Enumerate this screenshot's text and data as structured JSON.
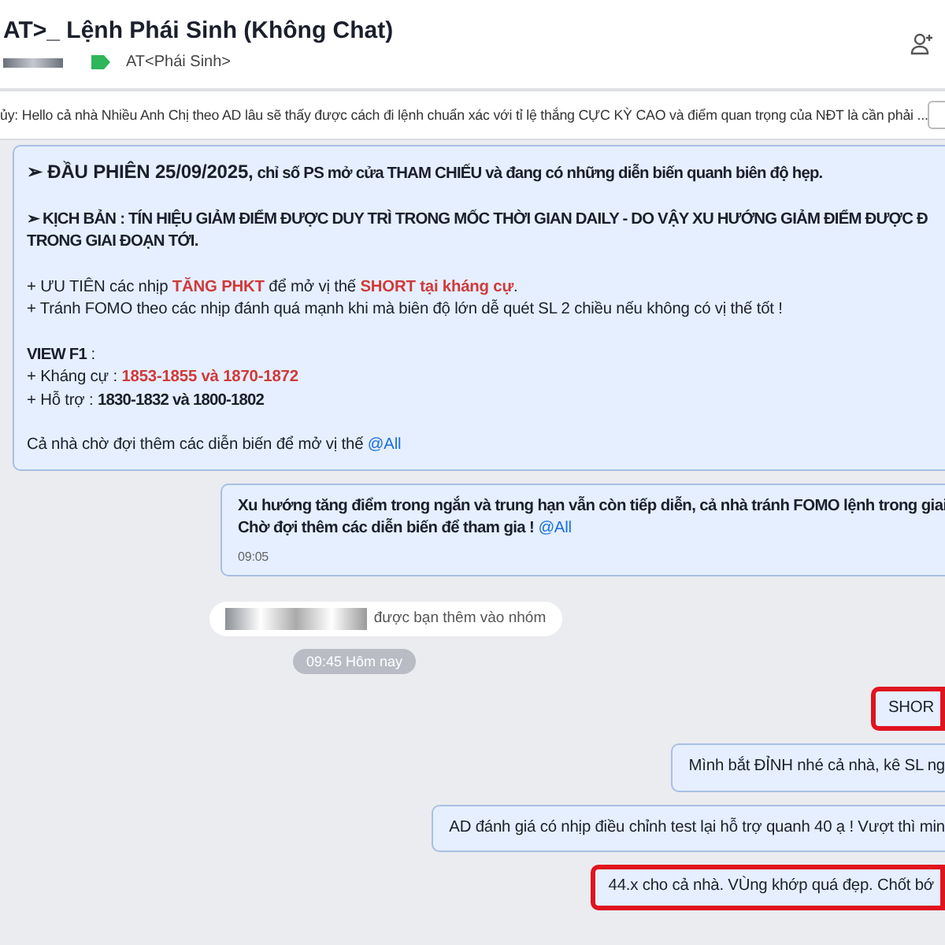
{
  "header": {
    "title": "AT>_ Lệnh Phái Sinh (Không Chat)",
    "tag": "AT<Phái Sinh>"
  },
  "pinned": {
    "text": "ủy: Hello cả nhà Nhiều Anh Chị theo AD lâu sẽ thấy được cách đi lệnh chuẩn xác với tỉ lệ thắng CỰC KỲ CAO và điểm quan trọng của NĐT là cần phải ..."
  },
  "messages": [
    {
      "kind": "bubble",
      "highlighted": false,
      "paragraphs": [
        [
          [
            {
              "kind": "heading",
              "text": "➢ ĐẦU PHIÊN 25/09/2025,"
            },
            {
              "kind": "strong",
              "text": " chỉ số PS mở cửa THAM CHIẾU và đang có những diễn biến quanh biên độ hẹp."
            }
          ]
        ],
        [
          [
            {
              "kind": "strong",
              "text": "➢ KỊCH BẢN : TÍN HIỆU GIẢM ĐIỂM ĐƯỢC DUY TRÌ TRONG MỐC THỜI GIAN DAILY - DO VẬY XU HƯỚNG GIẢM ĐIỂM ĐƯỢC Đ"
            }
          ],
          [
            {
              "kind": "strong",
              "text": "TRONG GIAI ĐOẠN TỚI."
            }
          ]
        ],
        [
          [
            {
              "kind": "plain",
              "text": "+ ƯU TIÊN các nhịp "
            },
            {
              "kind": "alert",
              "text": "TĂNG PHKT"
            },
            {
              "kind": "plain",
              "text": " để mở vị thế "
            },
            {
              "kind": "alert",
              "text": "SHORT tại kháng cự"
            },
            {
              "kind": "plain",
              "text": "."
            }
          ],
          [
            {
              "kind": "plain",
              "text": "+ Tránh FOMO theo các nhịp đánh quá mạnh khi mà biên độ lớn dễ quét SL 2 chiều nếu không có vị thế tốt !"
            }
          ]
        ],
        [
          [
            {
              "kind": "strong",
              "text": "VIEW F1"
            },
            {
              "kind": "plain",
              "text": " :"
            }
          ],
          [
            {
              "kind": "plain",
              "text": "+ Kháng cự :  "
            },
            {
              "kind": "alert",
              "text": "1853-1855 và 1870-1872"
            }
          ],
          [
            {
              "kind": "plain",
              "text": "+ Hỗ trợ      :  "
            },
            {
              "kind": "strong",
              "text": "1830-1832 và 1800-1802"
            }
          ]
        ],
        [
          [
            {
              "kind": "plain",
              "text": "Cả nhà chờ đợi thêm các diễn biến để mở vị thế "
            },
            {
              "kind": "mention",
              "text": "@All"
            }
          ]
        ]
      ]
    },
    {
      "kind": "bubble",
      "highlighted": false,
      "time": "09:05",
      "paragraphs": [
        [
          [
            {
              "kind": "strong",
              "text": "Xu hướng tăng điểm trong ngắn và trung hạn vẫn còn tiếp diễn, cả nhà tránh FOMO lệnh trong giai"
            }
          ],
          [
            {
              "kind": "strong",
              "text": "Chờ đợi thêm các diễn biến để tham gia ! "
            },
            {
              "kind": "mention",
              "text": "@All"
            }
          ]
        ]
      ]
    },
    {
      "kind": "system",
      "text": "được bạn thêm vào nhóm"
    },
    {
      "kind": "timestamp",
      "text": "09:45 Hôm nay"
    },
    {
      "kind": "bubble",
      "highlighted": true,
      "paragraphs": [
        [
          [
            {
              "kind": "plain",
              "text": "SHOR"
            }
          ]
        ]
      ]
    },
    {
      "kind": "bubble",
      "highlighted": false,
      "paragraphs": [
        [
          [
            {
              "kind": "plain",
              "text": "Mình bắt ĐỈNH nhé cả nhà, kê SL ng"
            }
          ]
        ]
      ]
    },
    {
      "kind": "bubble",
      "highlighted": false,
      "paragraphs": [
        [
          [
            {
              "kind": "plain",
              "text": "AD đánh giá có nhịp điều chỉnh test lại hỗ trợ quanh 40 ạ ! Vượt thì min"
            }
          ]
        ]
      ]
    },
    {
      "kind": "bubble",
      "highlighted": true,
      "paragraphs": [
        [
          [
            {
              "kind": "plain",
              "text": "44.x cho cả nhà. VÙng khớp quá đẹp. Chốt bớ"
            }
          ]
        ]
      ]
    }
  ]
}
